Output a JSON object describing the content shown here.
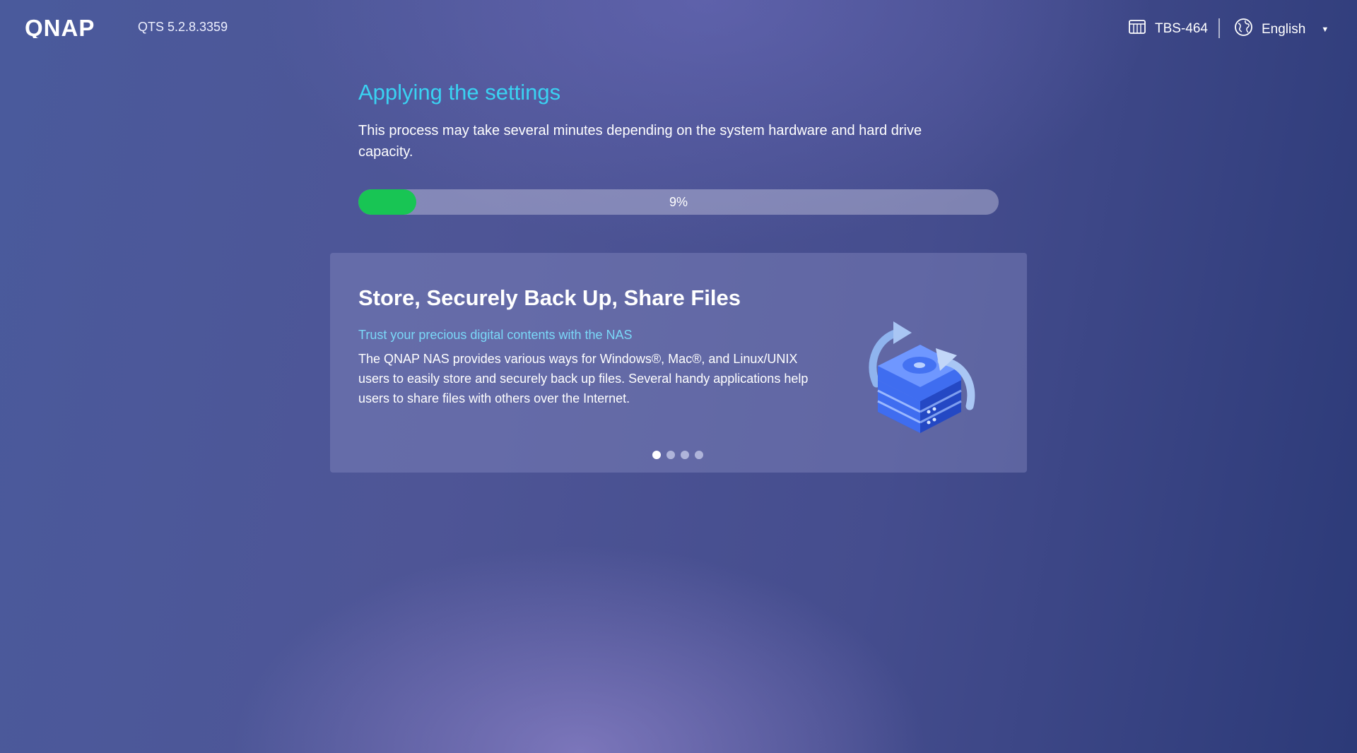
{
  "header": {
    "logo_text": "QNAP",
    "version": "QTS 5.2.8.3359",
    "model": "TBS-464",
    "language": "English",
    "icons": {
      "model": "nas-device-icon",
      "language": "globe-icon",
      "dropdown": "caret-down-icon"
    }
  },
  "main": {
    "title": "Applying the settings",
    "description": "This process may take several minutes depending on the system hardware and hard drive capacity.",
    "progress": {
      "percent": 9,
      "label": "9%"
    }
  },
  "carousel": {
    "active_index": 0,
    "slide_count": 4,
    "title": "Store, Securely Back Up, Share Files",
    "subtitle": "Trust your precious digital contents with the NAS",
    "body": "The QNAP NAS provides various ways for Windows®, Mac®, and Linux/UNIX users to easily store and securely back up files. Several handy applications help users to share files with others over the Internet.",
    "illustration": "storage-backup-icon"
  },
  "colors": {
    "accent_title": "#3ad2f2",
    "subtitle": "#7ad8f8",
    "progress_fill": "#18c554"
  }
}
